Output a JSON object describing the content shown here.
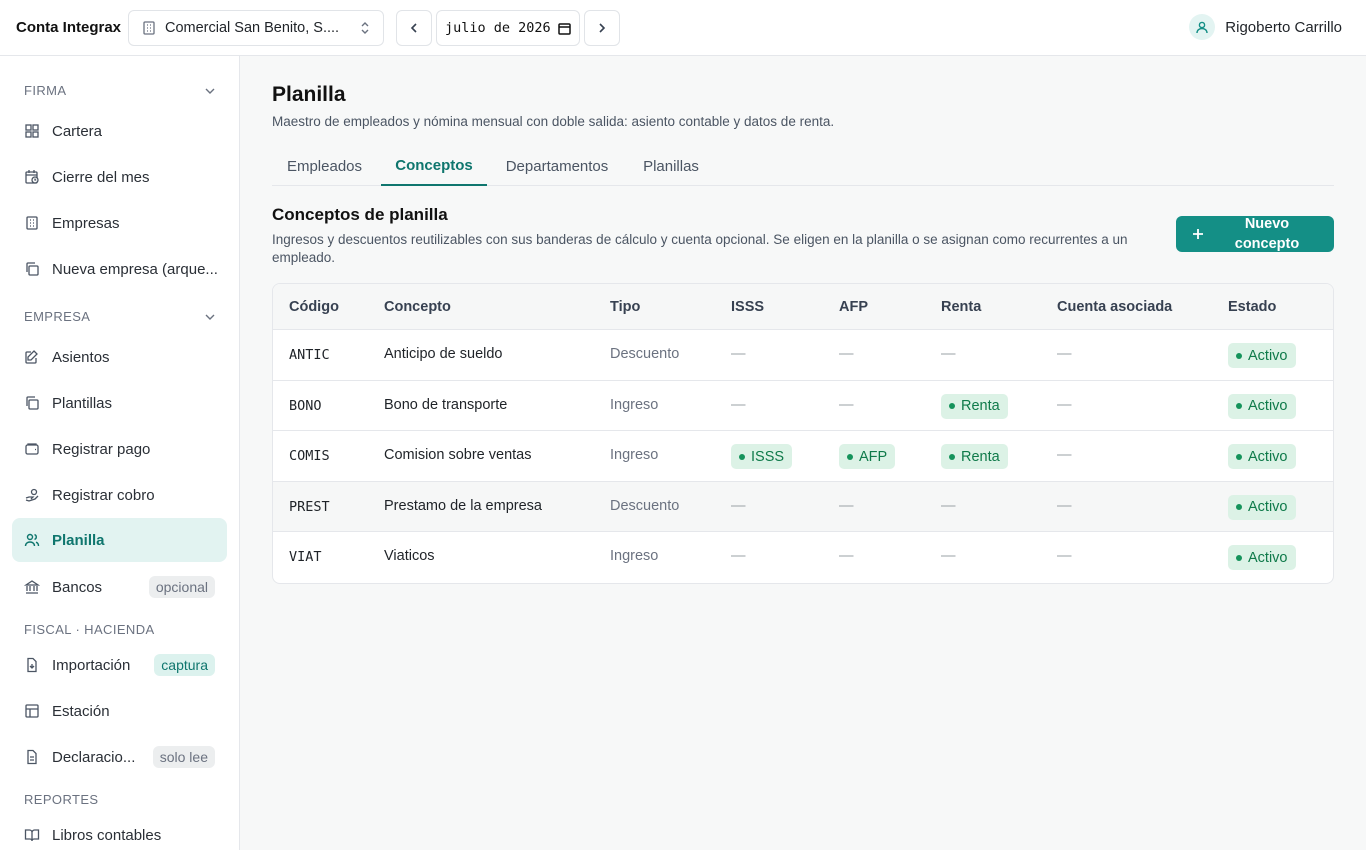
{
  "app": {
    "name": "Conta Integrax"
  },
  "topbar": {
    "company": "Comercial San Benito, S....",
    "month": "julio de 2026",
    "user": "Rigoberto Carrillo"
  },
  "sidebar": {
    "sections": {
      "firma": "FIRMA",
      "empresa": "EMPRESA",
      "fiscal": "FISCAL · HACIENDA",
      "reportes": "REPORTES"
    },
    "items": {
      "cartera": "Cartera",
      "cierre": "Cierre del mes",
      "empresas": "Empresas",
      "nueva_empresa": "Nueva empresa (arque...",
      "asientos": "Asientos",
      "plantillas": "Plantillas",
      "registrar_pago": "Registrar pago",
      "registrar_cobro": "Registrar cobro",
      "planilla": "Planilla",
      "bancos": "Bancos",
      "bancos_pill": "opcional",
      "importacion": "Importación",
      "importacion_pill": "captura",
      "estacion": "Estación",
      "declaraciones": "Declaracio...",
      "declaraciones_pill": "solo lee",
      "libros": "Libros contables"
    }
  },
  "page": {
    "title": "Planilla",
    "subtitle": "Maestro de empleados y nómina mensual con doble salida: asiento contable y datos de renta.",
    "tabs": [
      "Empleados",
      "Conceptos",
      "Departamentos",
      "Planillas"
    ],
    "section_title": "Conceptos de planilla",
    "section_desc": "Ingresos y descuentos reutilizables con sus banderas de cálculo y cuenta opcional. Se eligen en la planilla o se asignan como recurrentes a un empleado.",
    "new_button": "Nuevo concepto"
  },
  "table": {
    "headers": [
      "Código",
      "Concepto",
      "Tipo",
      "ISSS",
      "AFP",
      "Renta",
      "Cuenta asociada",
      "Estado"
    ],
    "rows": [
      {
        "codigo": "ANTIC",
        "concepto": "Anticipo de sueldo",
        "tipo": "Descuento",
        "isss": "—",
        "afp": "—",
        "renta": "—",
        "cuenta": "—",
        "estado": "Activo"
      },
      {
        "codigo": "BONO",
        "concepto": "Bono de transporte",
        "tipo": "Ingreso",
        "isss": "—",
        "afp": "—",
        "renta": "Renta",
        "cuenta": "—",
        "estado": "Activo"
      },
      {
        "codigo": "COMIS",
        "concepto": "Comision sobre ventas",
        "tipo": "Ingreso",
        "isss": "ISSS",
        "afp": "AFP",
        "renta": "Renta",
        "cuenta": "—",
        "estado": "Activo"
      },
      {
        "codigo": "PREST",
        "concepto": "Prestamo de la empresa",
        "tipo": "Descuento",
        "isss": "—",
        "afp": "—",
        "renta": "—",
        "cuenta": "—",
        "estado": "Activo"
      },
      {
        "codigo": "VIAT",
        "concepto": "Viaticos",
        "tipo": "Ingreso",
        "isss": "—",
        "afp": "—",
        "renta": "—",
        "cuenta": "—",
        "estado": "Activo"
      }
    ]
  },
  "colors": {
    "accent": "#148f86",
    "badge_bg": "#dcf2e6",
    "badge_text": "#0f7a4a"
  }
}
